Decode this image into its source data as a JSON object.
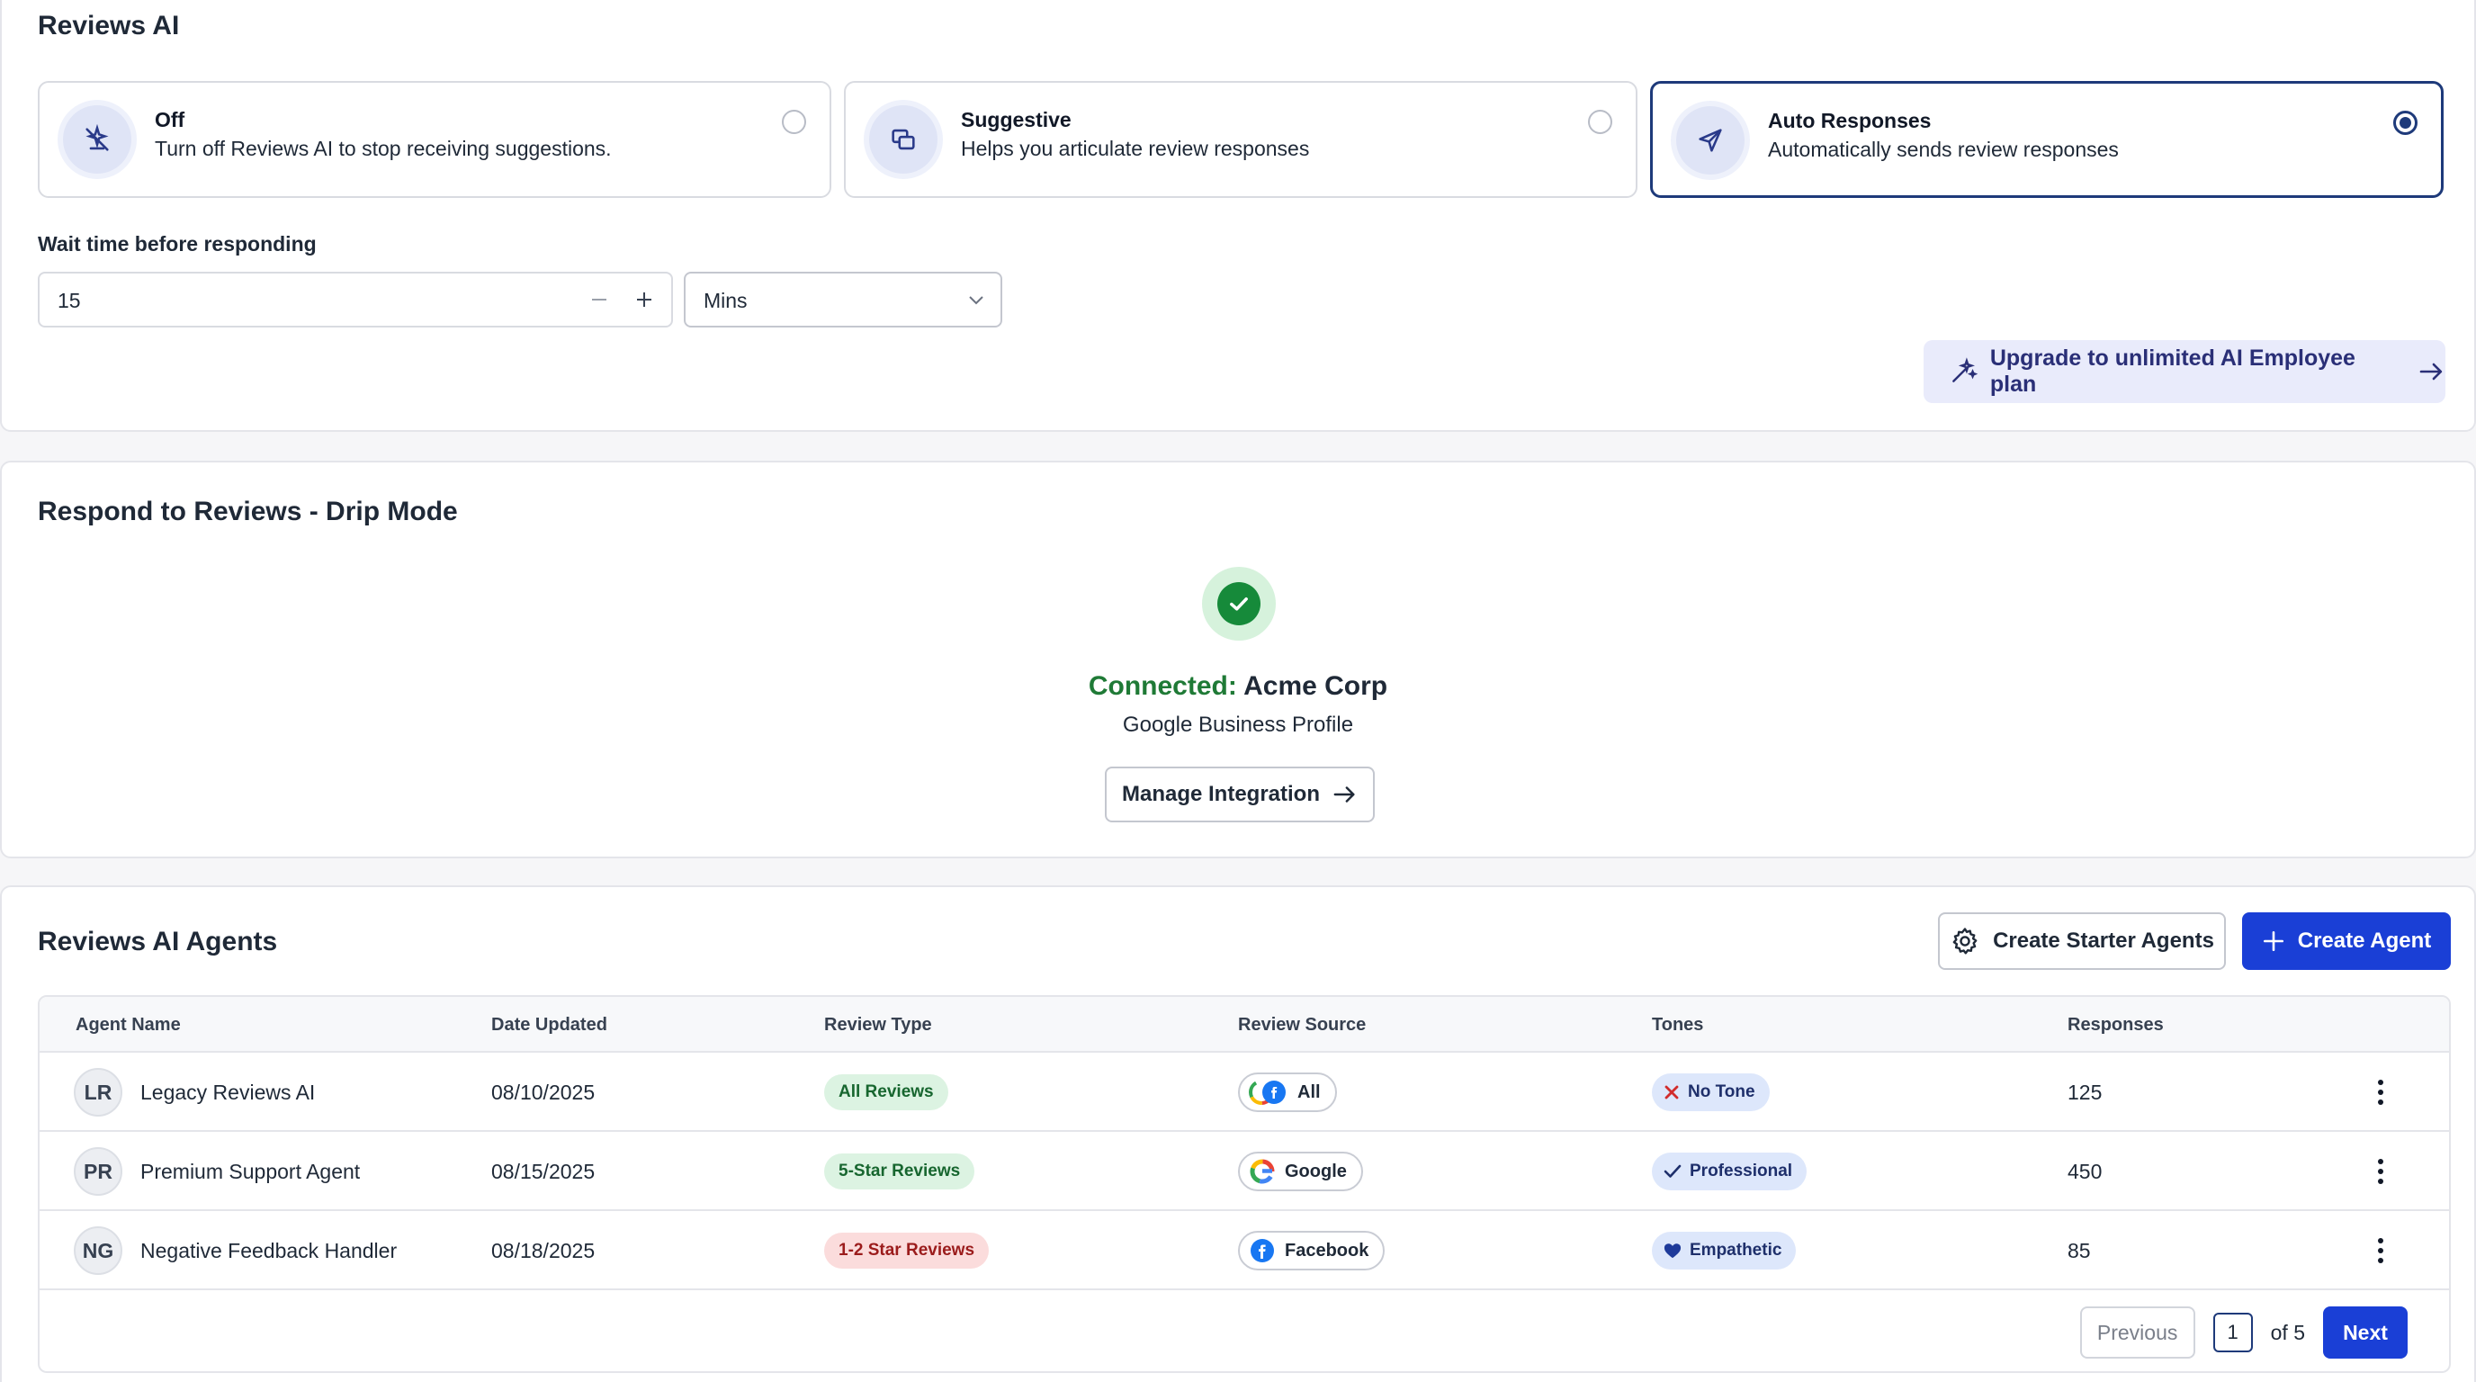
{
  "settings": {
    "title": "Reviews AI",
    "modes": [
      {
        "title": "Off",
        "description": "Turn off Reviews AI to stop receiving suggestions.",
        "icon": "ai-off-icon",
        "selected": false
      },
      {
        "title": "Suggestive",
        "description": "Helps you articulate review responses",
        "icon": "chat-suggest-icon",
        "selected": false
      },
      {
        "title": "Auto Responses",
        "description": "Automatically sends review responses",
        "icon": "send-icon",
        "selected": true
      }
    ],
    "wait_label": "Wait time before responding",
    "wait_value": "15",
    "wait_unit": "Mins",
    "upgrade_label": "Upgrade to unlimited AI Employee plan"
  },
  "drip": {
    "title": "Respond to Reviews - Drip Mode",
    "status": "Connected:",
    "account": "Acme Corp",
    "platform": "Google Business Profile",
    "manage_label": "Manage Integration"
  },
  "agents": {
    "title": "Reviews AI Agents",
    "starter_label": "Create Starter Agents",
    "create_label": "Create Agent",
    "columns": [
      "Agent Name",
      "Date Updated",
      "Review Type",
      "Review Source",
      "Tones",
      "Responses"
    ],
    "rows": [
      {
        "initials": "LR",
        "name": "Legacy Reviews AI",
        "date": "08/10/2025",
        "review_type": "All Reviews",
        "source": "All",
        "tone": "No Tone",
        "responses": "125"
      },
      {
        "initials": "PR",
        "name": "Premium Support Agent",
        "date": "08/15/2025",
        "review_type": "5-Star Reviews",
        "source": "Google",
        "tone": "Professional",
        "responses": "450"
      },
      {
        "initials": "NG",
        "name": "Negative Feedback Handler",
        "date": "08/18/2025",
        "review_type": "1-2 Star Reviews",
        "source": "Facebook",
        "tone": "Empathetic",
        "responses": "85"
      }
    ],
    "pagination": {
      "previous": "Previous",
      "page": "1",
      "of": "of 5",
      "next": "Next"
    }
  },
  "colors": {
    "accent": "#1a3fd6",
    "selected_border": "#1e3a7a",
    "connected_green": "#1f7a36",
    "pill_green_bg": "#dcf3e2",
    "pill_red_bg": "#fbdcdc"
  }
}
